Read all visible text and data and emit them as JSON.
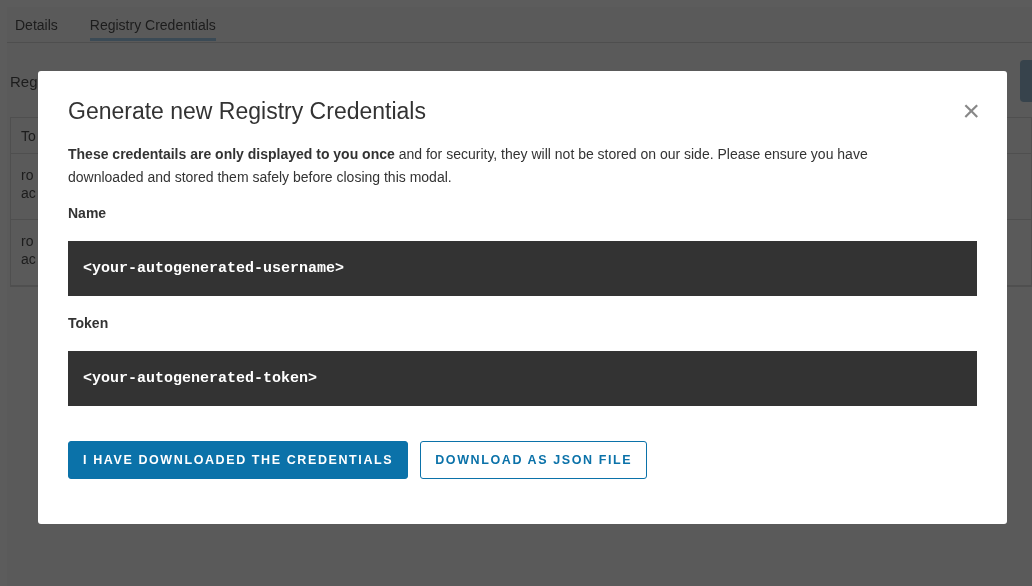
{
  "tabs": [
    {
      "label": "Details",
      "selected": false
    },
    {
      "label": "Registry Credentials",
      "selected": true
    }
  ],
  "page_heading": "Reg",
  "table": {
    "columns": [
      "To"
    ],
    "rows": [
      [
        "ro",
        "ac"
      ],
      [
        "ro",
        "ac"
      ]
    ]
  },
  "modal": {
    "title": "Generate new Registry Credentials",
    "close": "×",
    "notice": "**These credentails are only displayed to you once** and for security, they will not be stored on our side. Please ensure you have downloaded and stored them safely before closing this modal.",
    "fields": [
      {
        "label": "Name",
        "value": "<your-autogenerated-username>"
      },
      {
        "label": "Token",
        "value": "<your-autogenerated-token>"
      }
    ],
    "buttons": [
      {
        "label": "I HAVE DOWNLOADED THE CREDENTIALS",
        "kind": "primary"
      },
      {
        "label": "DOWNLOAD AS JSON FILE",
        "kind": "outline"
      }
    ]
  }
}
